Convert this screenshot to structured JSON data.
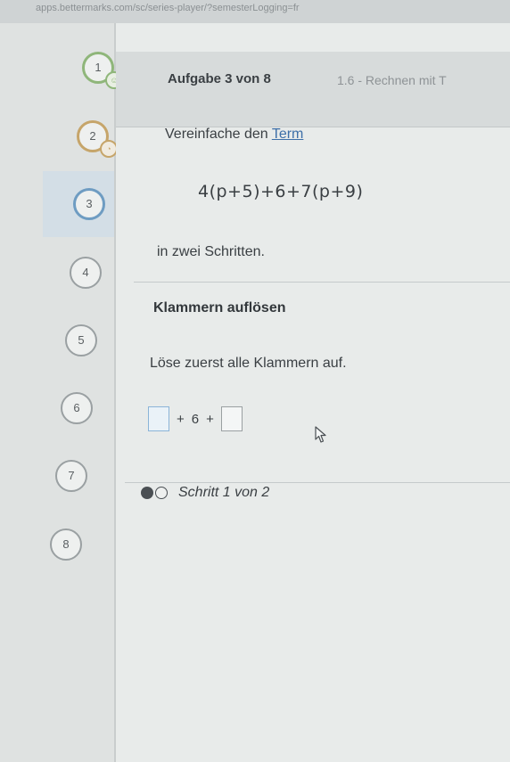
{
  "browser": {
    "url": "apps.bettermarks.com/sc/series-player/?semesterLogging=fr"
  },
  "sidebar": {
    "steps": [
      {
        "label": "1",
        "state": "done",
        "badge": "☺"
      },
      {
        "label": "2",
        "state": "partial",
        "badge": "◔"
      },
      {
        "label": "3",
        "state": "active"
      },
      {
        "label": "4",
        "state": "open"
      },
      {
        "label": "5",
        "state": "open"
      },
      {
        "label": "6",
        "state": "open"
      },
      {
        "label": "7",
        "state": "open"
      },
      {
        "label": "8",
        "state": "open"
      }
    ]
  },
  "header": {
    "title": "Aufgabe 3 von 8",
    "subtitle": "1.6 - Rechnen mit T"
  },
  "task": {
    "intro_prefix": "Vereinfache den ",
    "intro_link": "Term",
    "expression": "4(p+5)+6+7(p+9)",
    "hint": "in zwei Schritten."
  },
  "step": {
    "title": "Klammern auflösen",
    "instruction": "Löse zuerst alle Klammern auf.",
    "operator_1": "+",
    "constant": "6",
    "operator_2": "+"
  },
  "progress": {
    "label": "Schritt 1 von 2",
    "current": 1,
    "total": 2
  },
  "colors": {
    "done": "#8fb67a",
    "partial": "#c6a56a",
    "active": "#6e9cc2",
    "link": "#3d6fa8"
  }
}
